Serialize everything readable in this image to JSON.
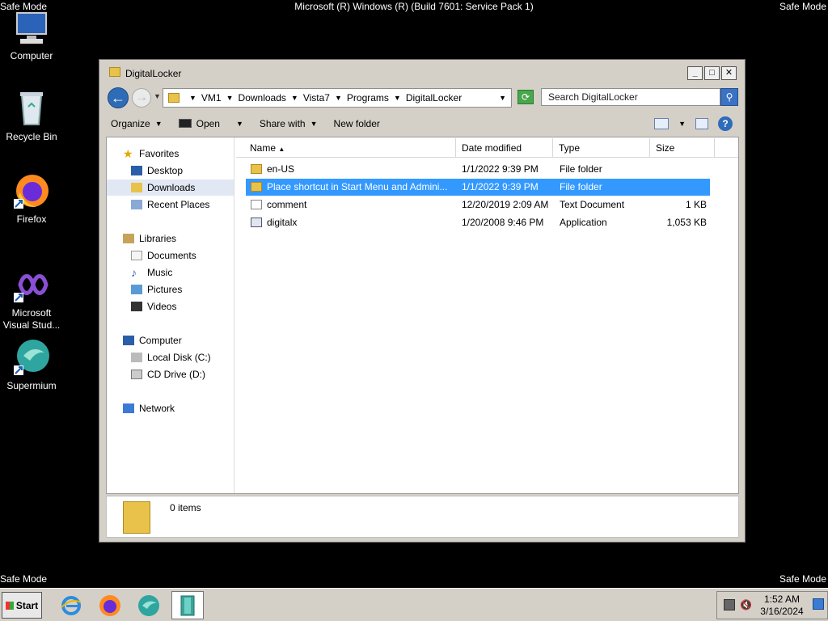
{
  "os": {
    "title": "Microsoft (R) Windows (R) (Build 7601: Service Pack 1)",
    "safe_mode_label": "Safe Mode"
  },
  "desktop": {
    "icons": [
      {
        "label": "Computer"
      },
      {
        "label": "Recycle Bin"
      },
      {
        "label": "Firefox"
      },
      {
        "label": "Microsoft Visual Stud..."
      },
      {
        "label": "Supermium"
      }
    ]
  },
  "window": {
    "title": "DigitalLocker",
    "buttons": {
      "minimize": "_",
      "maximize": "□",
      "close": "✕"
    },
    "address": {
      "crumbs": [
        "VM1",
        "Downloads",
        "Vista7",
        "Programs",
        "DigitalLocker"
      ]
    },
    "search": {
      "placeholder": "Search DigitalLocker"
    },
    "commands": {
      "organize": "Organize",
      "open": "Open",
      "share_with": "Share with",
      "new_folder": "New folder"
    },
    "nav": {
      "favorites": "Favorites",
      "desktop": "Desktop",
      "downloads": "Downloads",
      "recent_places": "Recent Places",
      "libraries": "Libraries",
      "documents": "Documents",
      "music": "Music",
      "pictures": "Pictures",
      "videos": "Videos",
      "computer": "Computer",
      "local_disk": "Local Disk (C:)",
      "cd_drive": "CD Drive (D:)",
      "network": "Network"
    },
    "columns": {
      "name": "Name",
      "date_modified": "Date modified",
      "type": "Type",
      "size": "Size"
    },
    "files": [
      {
        "name": "en-US",
        "date": "1/1/2022 9:39 PM",
        "type": "File folder",
        "size": ""
      },
      {
        "name": "Place shortcut in Start Menu and Admini...",
        "date": "1/1/2022 9:39 PM",
        "type": "File folder",
        "size": ""
      },
      {
        "name": "comment",
        "date": "12/20/2019 2:09 AM",
        "type": "Text Document",
        "size": "1 KB"
      },
      {
        "name": "digitalx",
        "date": "1/20/2008 9:46 PM",
        "type": "Application",
        "size": "1,053 KB"
      }
    ],
    "details": {
      "count": "0 items"
    }
  },
  "taskbar": {
    "start_label": "Start",
    "clock_time": "1:52 AM",
    "clock_date": "3/16/2024"
  },
  "colors": {
    "selection": "#3399ff",
    "desktop_bg": "#000000",
    "chrome": "#d4d0c8"
  }
}
